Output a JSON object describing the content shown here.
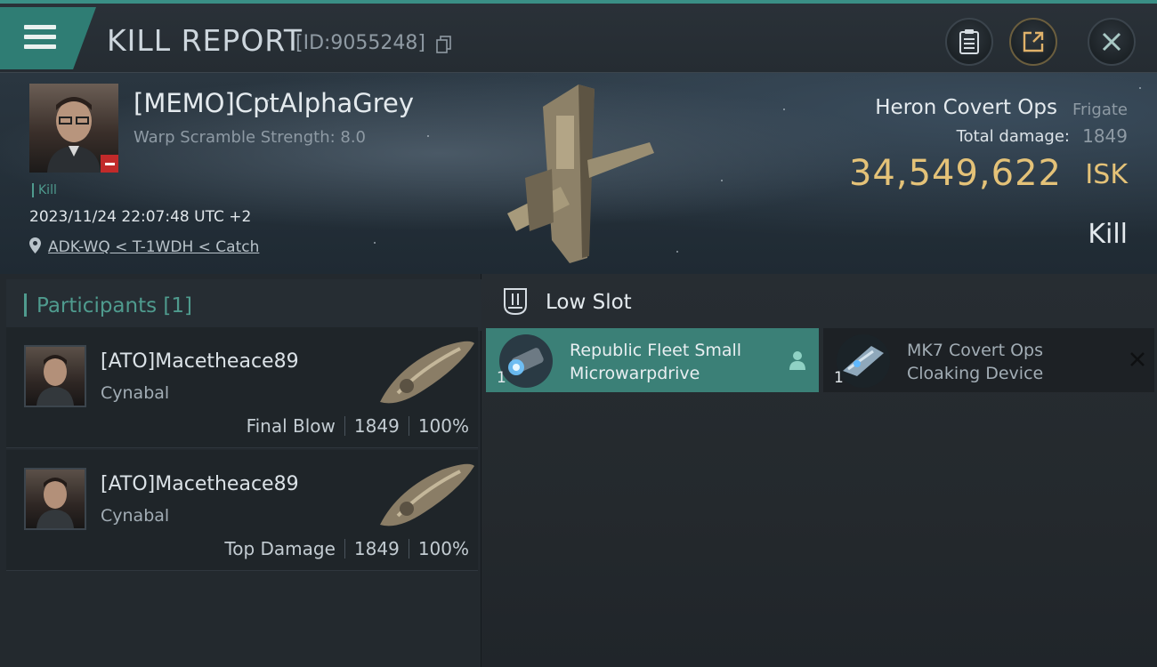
{
  "header": {
    "title": "KILL REPORT",
    "report_id": "[ID:9055248]",
    "icons": {
      "menu": "hamburger-icon",
      "copy": "copy-icon",
      "clipboard": "clipboard-icon",
      "export": "export-icon",
      "close": "close-icon"
    }
  },
  "victim": {
    "name": "[MEMO]CptAlphaGrey",
    "warp_scramble": "Warp Scramble Strength: 8.0",
    "kill_tag": "Kill",
    "timestamp": "2023/11/24 22:07:48 UTC +2",
    "location": "ADK-WQ < T-1WDH < Catch",
    "ship_name": "Heron Covert Ops",
    "ship_class": "Frigate",
    "total_damage_label": "Total damage:",
    "total_damage_value": "1849",
    "isk_value": "34,549,622",
    "isk_unit": "ISK",
    "result": "Kill"
  },
  "participants": {
    "title": "Participants [1]",
    "items": [
      {
        "name": "[ATO]Macetheace89",
        "ship": "Cynabal",
        "role": "Final Blow",
        "damage": "1849",
        "percent": "100%"
      },
      {
        "name": "[ATO]Macetheace89",
        "ship": "Cynabal",
        "role": "Top Damage",
        "damage": "1849",
        "percent": "100%"
      }
    ]
  },
  "low_slot": {
    "title": "Low Slot",
    "modules": [
      {
        "name_line1": "Republic Fleet Small",
        "name_line2": "Microwarpdrive",
        "qty": "1",
        "status": "dropped"
      },
      {
        "name_line1": "MK7 Covert Ops",
        "name_line2": "Cloaking Device",
        "qty": "1",
        "status": "destroyed"
      }
    ]
  },
  "colors": {
    "accent_teal": "#3b8077",
    "isk_gold": "#e4c278",
    "victim_marker_red": "#c12a2a"
  }
}
